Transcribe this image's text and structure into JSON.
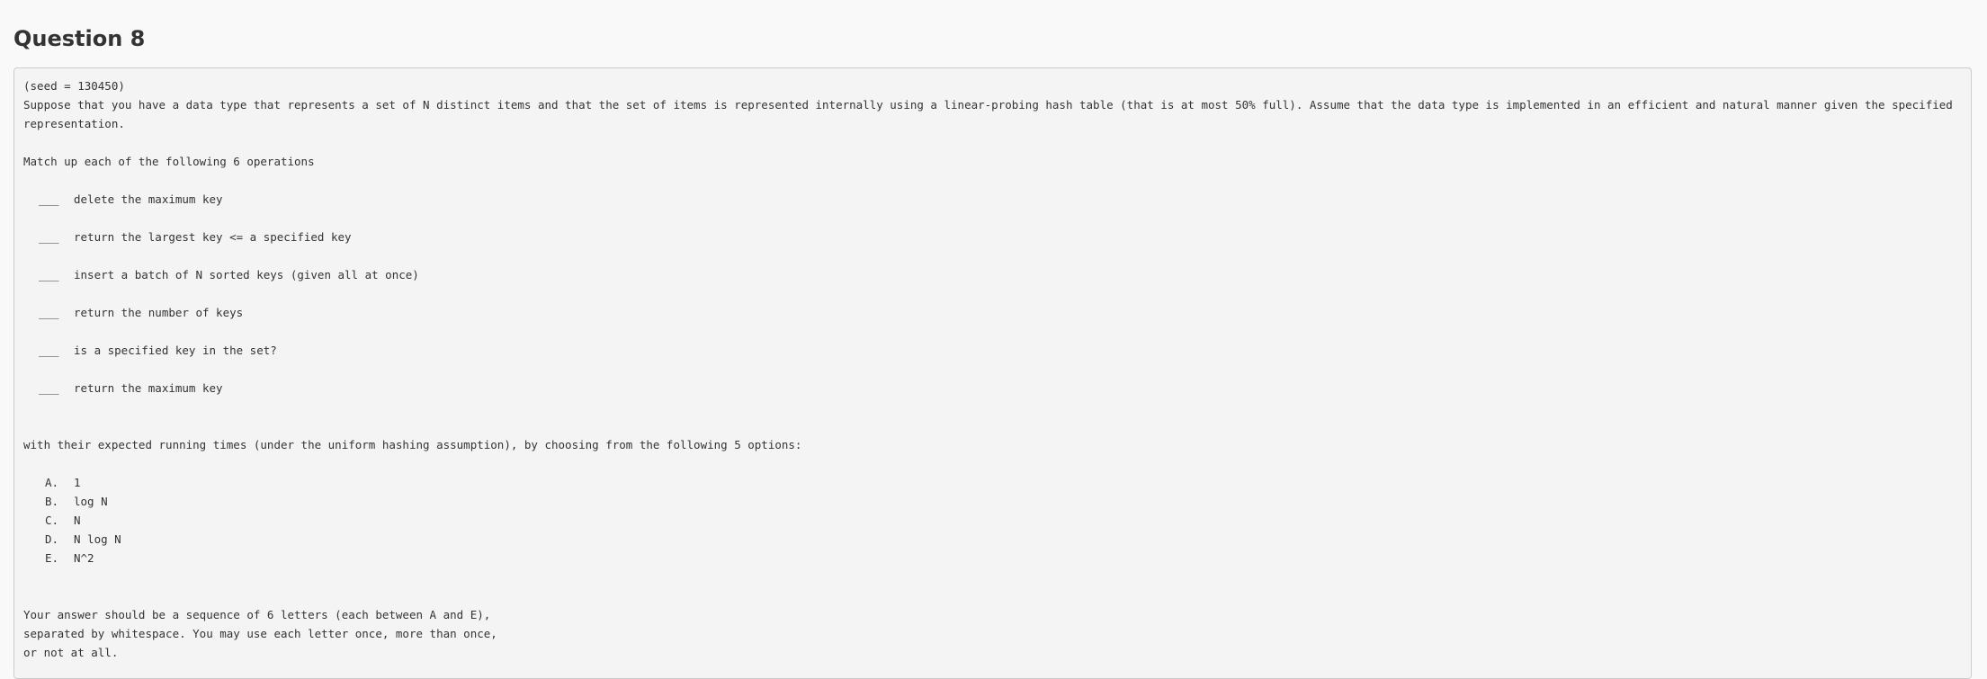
{
  "question": {
    "title": "Question 8",
    "seed_line": "(seed = 130450)",
    "description": "Suppose that you have a data type that represents a set of N distinct items and that the set of items is represented internally using a linear-probing hash table (that is at most 50% full). Assume that the data type is implemented in an efficient and natural manner given the specified representation.",
    "match_intro": "Match up each of the following 6 operations",
    "blank": "___",
    "operations": [
      "delete the maximum key",
      "return the largest key <= a specified key",
      "insert a batch of N sorted keys (given all at once)",
      "return the number of keys",
      "is a specified key in the set?",
      "return the maximum key"
    ],
    "options_intro": "with their expected running times (under the uniform hashing assumption), by choosing from the following 5 options:",
    "options": [
      {
        "letter": "A.",
        "text": "1"
      },
      {
        "letter": "B.",
        "text": "log N"
      },
      {
        "letter": "C.",
        "text": "N"
      },
      {
        "letter": "D.",
        "text": "N log N"
      },
      {
        "letter": "E.",
        "text": "N^2"
      }
    ],
    "instructions": [
      "Your answer should be a sequence of 6 letters (each between A and E),",
      "separated by whitespace. You may use each letter once, more than once,",
      "or not at all."
    ]
  }
}
